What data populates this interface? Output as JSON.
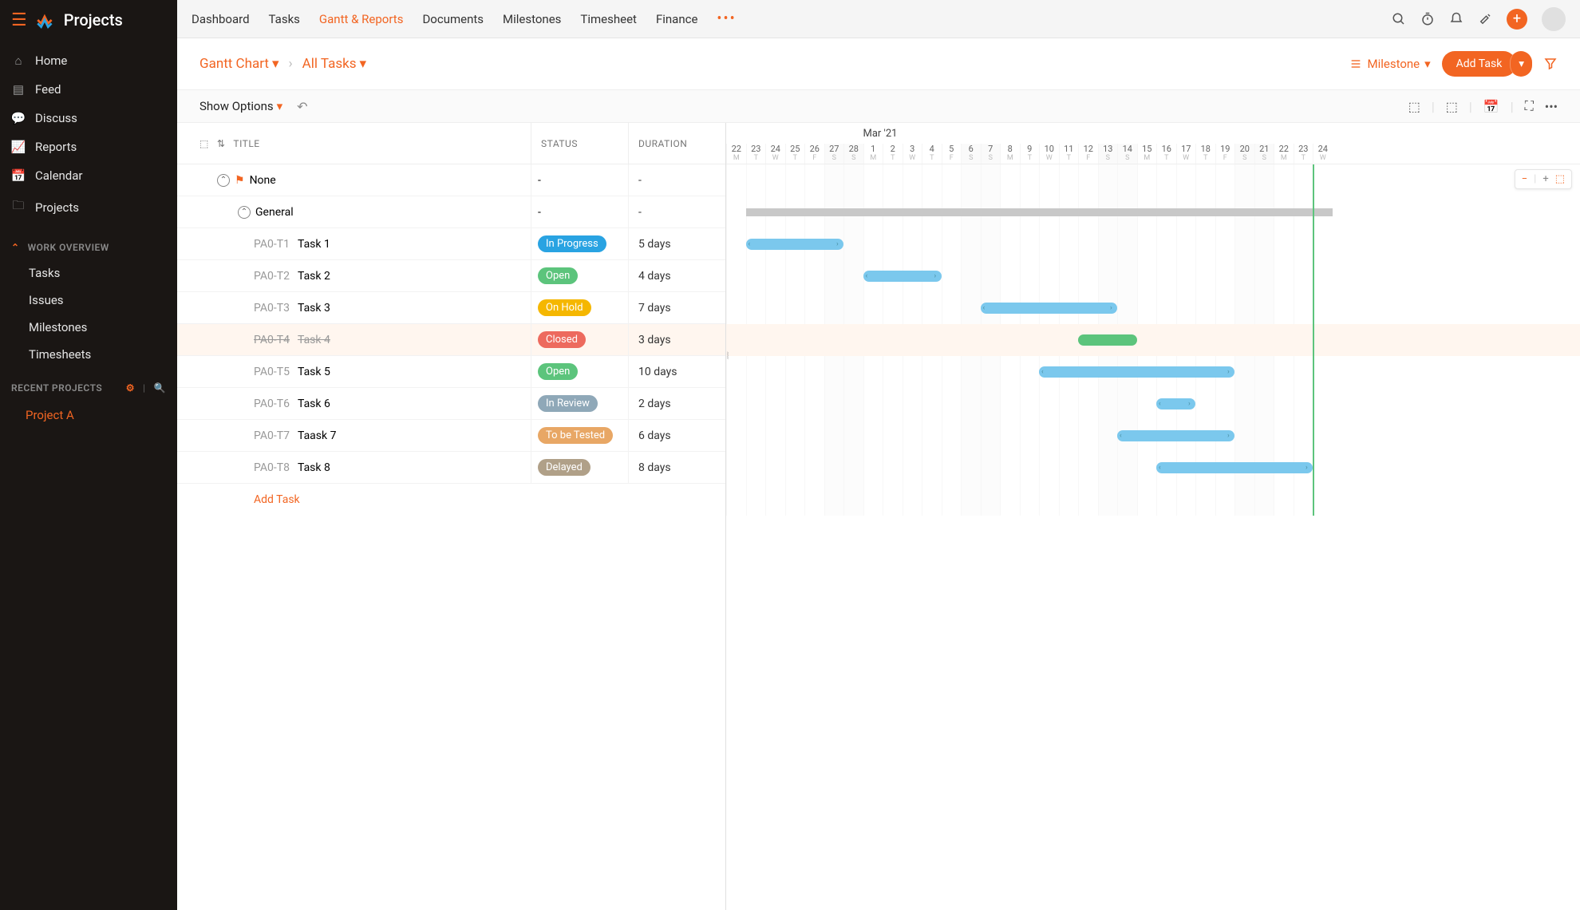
{
  "app": {
    "name": "Projects"
  },
  "sidebar": {
    "items": [
      {
        "label": "Home"
      },
      {
        "label": "Feed"
      },
      {
        "label": "Discuss"
      },
      {
        "label": "Reports"
      },
      {
        "label": "Calendar"
      },
      {
        "label": "Projects"
      }
    ],
    "work_overview_label": "WORK OVERVIEW",
    "work_items": [
      {
        "label": "Tasks"
      },
      {
        "label": "Issues"
      },
      {
        "label": "Milestones"
      },
      {
        "label": "Timesheets"
      }
    ],
    "recent_label": "RECENT PROJECTS",
    "recent_items": [
      {
        "label": "Project A"
      }
    ]
  },
  "topnav": {
    "items": [
      {
        "label": "Dashboard"
      },
      {
        "label": "Tasks"
      },
      {
        "label": "Gantt & Reports"
      },
      {
        "label": "Documents"
      },
      {
        "label": "Milestones"
      },
      {
        "label": "Timesheet"
      },
      {
        "label": "Finance"
      }
    ],
    "active_index": 2
  },
  "breadcrumb": {
    "a": "Gantt Chart",
    "b": "All Tasks"
  },
  "subheader": {
    "milestone_label": "Milestone",
    "add_task_label": "Add Task"
  },
  "toolbar": {
    "show_options": "Show Options"
  },
  "columns": {
    "title": "TITLE",
    "status": "STATUS",
    "duration": "DURATION"
  },
  "groups": {
    "none": "None",
    "general": "General"
  },
  "tasks": [
    {
      "id": "PA0-T1",
      "name": "Task 1",
      "status": "In Progress",
      "status_color": "#29a3e2",
      "duration": "5 days",
      "start_col": 1,
      "span": 5,
      "closed": false
    },
    {
      "id": "PA0-T2",
      "name": "Task 2",
      "status": "Open",
      "status_color": "#5cc47c",
      "duration": "4 days",
      "start_col": 7,
      "span": 4,
      "closed": false
    },
    {
      "id": "PA0-T3",
      "name": "Task 3",
      "status": "On Hold",
      "status_color": "#f5b700",
      "duration": "7 days",
      "start_col": 13,
      "span": 7,
      "closed": false
    },
    {
      "id": "PA0-T4",
      "name": "Task 4",
      "status": "Closed",
      "status_color": "#ed6a5e",
      "duration": "3 days",
      "start_col": 18,
      "span": 3,
      "closed": true
    },
    {
      "id": "PA0-T5",
      "name": "Task 5",
      "status": "Open",
      "status_color": "#5cc47c",
      "duration": "10 days",
      "start_col": 16,
      "span": 10,
      "closed": false
    },
    {
      "id": "PA0-T6",
      "name": "Task 6",
      "status": "In Review",
      "status_color": "#8fa8b8",
      "duration": "2 days",
      "start_col": 22,
      "span": 2,
      "closed": false
    },
    {
      "id": "PA0-T7",
      "name": "Taask 7",
      "status": "To be Tested",
      "status_color": "#e8a765",
      "duration": "6 days",
      "start_col": 20,
      "span": 6,
      "closed": false
    },
    {
      "id": "PA0-T8",
      "name": "Task 8",
      "status": "Delayed",
      "status_color": "#b0a088",
      "duration": "8 days",
      "start_col": 22,
      "span": 8,
      "closed": false
    }
  ],
  "add_task_link": "Add Task",
  "timeline": {
    "month_label": "Mar '21",
    "month_start_col": 7,
    "days": [
      {
        "n": "22",
        "d": "M"
      },
      {
        "n": "23",
        "d": "T"
      },
      {
        "n": "24",
        "d": "W"
      },
      {
        "n": "25",
        "d": "T"
      },
      {
        "n": "26",
        "d": "F"
      },
      {
        "n": "27",
        "d": "S",
        "w": true
      },
      {
        "n": "28",
        "d": "S",
        "w": true
      },
      {
        "n": "1",
        "d": "M"
      },
      {
        "n": "2",
        "d": "T"
      },
      {
        "n": "3",
        "d": "W"
      },
      {
        "n": "4",
        "d": "T"
      },
      {
        "n": "5",
        "d": "F"
      },
      {
        "n": "6",
        "d": "S",
        "w": true
      },
      {
        "n": "7",
        "d": "S",
        "w": true
      },
      {
        "n": "8",
        "d": "M"
      },
      {
        "n": "9",
        "d": "T"
      },
      {
        "n": "10",
        "d": "W"
      },
      {
        "n": "11",
        "d": "T"
      },
      {
        "n": "12",
        "d": "F"
      },
      {
        "n": "13",
        "d": "S",
        "w": true
      },
      {
        "n": "14",
        "d": "S",
        "w": true
      },
      {
        "n": "15",
        "d": "M"
      },
      {
        "n": "16",
        "d": "T"
      },
      {
        "n": "17",
        "d": "W"
      },
      {
        "n": "18",
        "d": "T"
      },
      {
        "n": "19",
        "d": "F"
      },
      {
        "n": "20",
        "d": "S",
        "w": true
      },
      {
        "n": "21",
        "d": "S",
        "w": true
      },
      {
        "n": "22",
        "d": "M"
      },
      {
        "n": "23",
        "d": "T"
      },
      {
        "n": "24",
        "d": "W"
      }
    ],
    "today_col": 30
  },
  "chart_data": {
    "type": "gantt",
    "title": "Gantt Chart — All Tasks",
    "x_unit": "days",
    "x_start": "2021-02-22",
    "series": [
      {
        "name": "Task 1",
        "start": "2021-02-22",
        "duration_days": 5,
        "status": "In Progress"
      },
      {
        "name": "Task 2",
        "start": "2021-03-01",
        "duration_days": 4,
        "status": "Open"
      },
      {
        "name": "Task 3",
        "start": "2021-03-07",
        "duration_days": 7,
        "status": "On Hold"
      },
      {
        "name": "Task 4",
        "start": "2021-03-12",
        "duration_days": 3,
        "status": "Closed"
      },
      {
        "name": "Task 5",
        "start": "2021-03-10",
        "duration_days": 10,
        "status": "Open"
      },
      {
        "name": "Task 6",
        "start": "2021-03-16",
        "duration_days": 2,
        "status": "In Review"
      },
      {
        "name": "Task 7",
        "start": "2021-03-14",
        "duration_days": 6,
        "status": "To be Tested"
      },
      {
        "name": "Task 8",
        "start": "2021-03-16",
        "duration_days": 8,
        "status": "Delayed"
      }
    ]
  }
}
